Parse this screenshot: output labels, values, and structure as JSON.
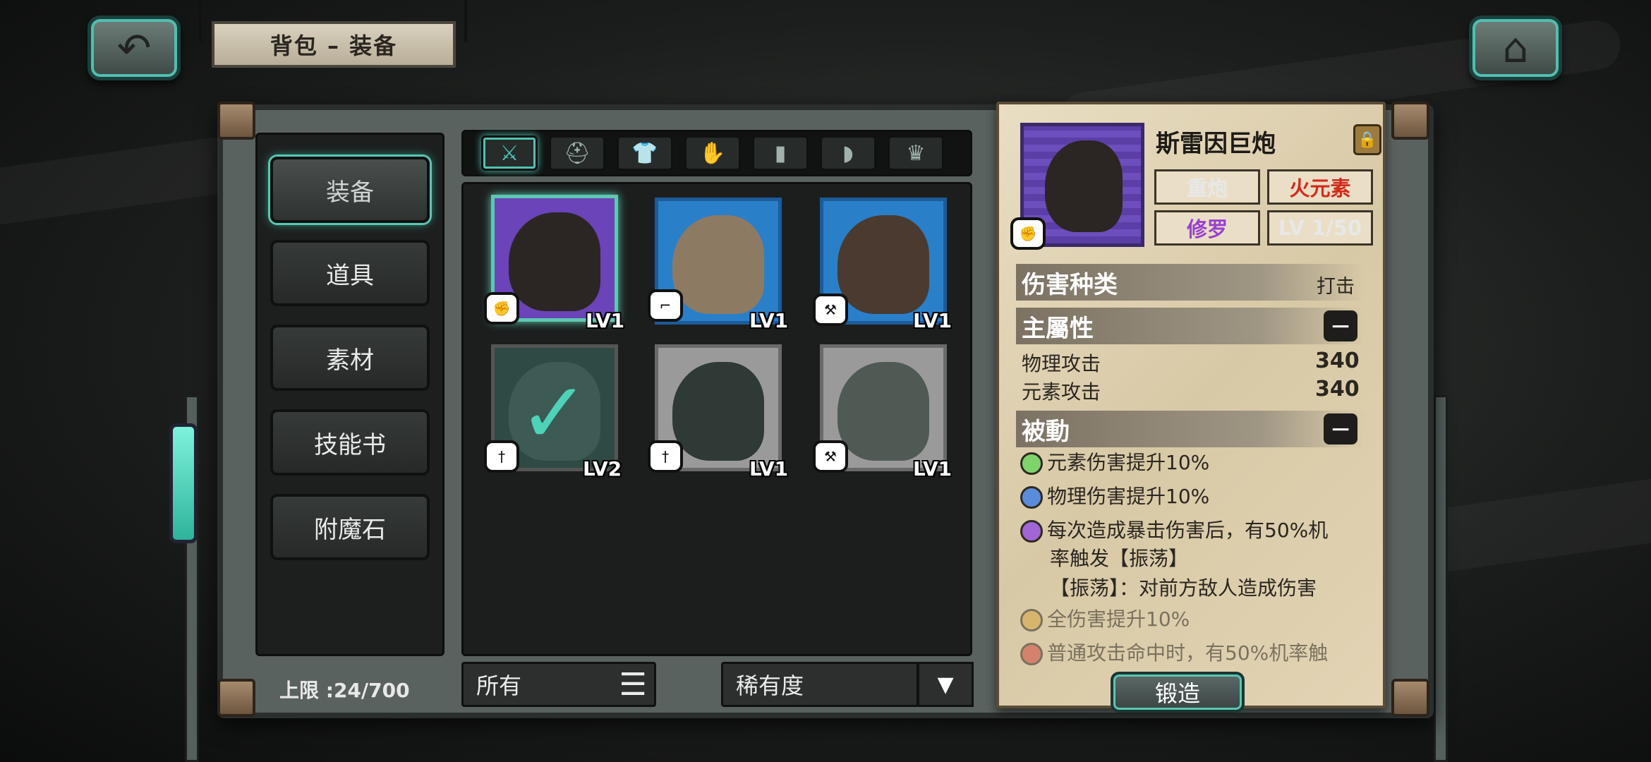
{
  "header": {
    "back_icon": "back-arrow-icon",
    "title": "背包 – 装备",
    "home_icon": "home-icon"
  },
  "sidebar": {
    "items": [
      {
        "label": "装备",
        "active": true
      },
      {
        "label": "道具",
        "active": false
      },
      {
        "label": "素材",
        "active": false
      },
      {
        "label": "技能书",
        "active": false
      },
      {
        "label": "附魔石",
        "active": false
      }
    ],
    "limit_label": "上限 :24/700"
  },
  "tabs": [
    {
      "icon": "crossed-swords-icon",
      "glyph": "⚔",
      "active": true
    },
    {
      "icon": "helmet-icon",
      "glyph": "⛑",
      "active": false
    },
    {
      "icon": "armor-icon",
      "glyph": "👕",
      "active": false
    },
    {
      "icon": "glove-icon",
      "glyph": "✋",
      "active": false
    },
    {
      "icon": "pants-icon",
      "glyph": "▮",
      "active": false
    },
    {
      "icon": "boots-icon",
      "glyph": "◗",
      "active": false
    },
    {
      "icon": "crown-icon",
      "glyph": "♛",
      "active": false
    }
  ],
  "items": [
    {
      "level": "LV1",
      "rarity_color": "#6a44b8",
      "art_color": "#2b2623",
      "selected": true
    },
    {
      "level": "LV1",
      "rarity_color": "#2a7fc9",
      "art_color": "#8d7a63",
      "selected": false
    },
    {
      "level": "LV1",
      "rarity_color": "#2a7fc9",
      "art_color": "#4a3a2f",
      "selected": false
    },
    {
      "level": "LV2",
      "rarity_color": "#2f4a44",
      "art_color": "#3d5a55",
      "selected": false,
      "equipped": true
    },
    {
      "level": "LV1",
      "rarity_color": "#9a9a9a",
      "art_color": "#2f3a36",
      "selected": false
    },
    {
      "level": "LV1",
      "rarity_color": "#9a9a9a",
      "art_color": "#4f5a55",
      "selected": false
    }
  ],
  "filters": {
    "type_value": "所有",
    "sort_value": "稀有度"
  },
  "detail": {
    "name": "斯雷因巨炮",
    "tags": {
      "type": "重炮",
      "element": "火元素",
      "race": "修罗",
      "level": "LV 1/50"
    },
    "damage_type_label": "伤害种类",
    "damage_type_value": "打击",
    "main_attr_label": "主屬性",
    "stats": [
      {
        "label": "物理攻击",
        "value": "340"
      },
      {
        "label": "元素攻击",
        "value": "340"
      }
    ],
    "passive_label": "被動",
    "passives": [
      {
        "text": "元素伤害提升10%",
        "color": "#7ed36b",
        "locked": false
      },
      {
        "text": "物理伤害提升10%",
        "color": "#5b8cdb",
        "locked": false
      },
      {
        "text": "每次造成暴击伤害后，有50%机",
        "text2": "率触发【振荡】",
        "color": "#a165d6",
        "locked": false
      },
      {
        "text": "【振荡】：对前方敌人造成伤害",
        "color": "",
        "locked": false
      },
      {
        "text": "全伤害提升10%",
        "color": "#d4a640",
        "locked": true
      },
      {
        "text": "普通攻击命中时，有50%机率触",
        "color": "#d0473f",
        "locked": true
      }
    ],
    "forge_label": "锻造"
  },
  "colors": {
    "accent": "#4fc3b1",
    "element_fire": "#d22b1c",
    "race_purple": "#9a3fd0"
  }
}
